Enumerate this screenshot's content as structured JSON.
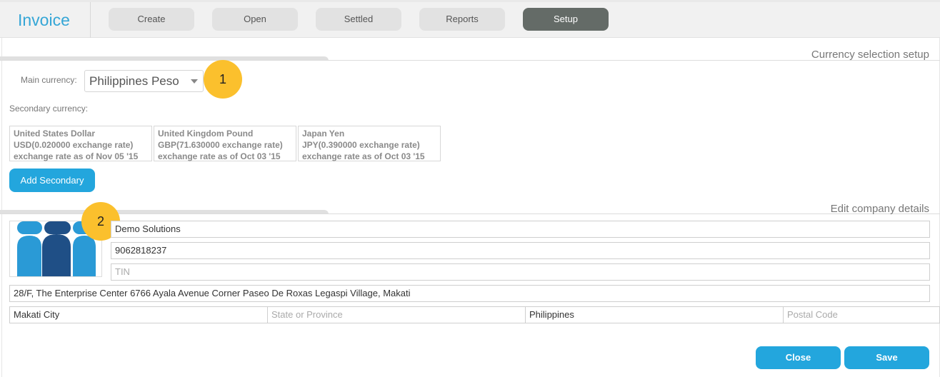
{
  "app": {
    "title": "Invoice"
  },
  "nav": {
    "tabs": [
      {
        "label": "Create"
      },
      {
        "label": "Open"
      },
      {
        "label": "Settled"
      },
      {
        "label": "Reports"
      },
      {
        "label": "Setup",
        "active": true
      }
    ]
  },
  "currency_section": {
    "title": "Currency selection setup",
    "main_label": "Main currency:",
    "main_value": "Philippines Peso",
    "secondary_label": "Secondary currency:",
    "secondary": [
      {
        "name": "United States Dollar",
        "rate": "USD(0.020000 exchange rate)",
        "as_of": "exchange rate as of Nov 05 '15"
      },
      {
        "name": "United Kingdom Pound",
        "rate": "GBP(71.630000 exchange rate)",
        "as_of": "exchange rate as of Oct 03 '15"
      },
      {
        "name": "Japan Yen",
        "rate": "JPY(0.390000 exchange rate)",
        "as_of": "exchange rate as of Oct 03 '15"
      }
    ],
    "add_button": "Add Secondary"
  },
  "markers": {
    "one": "1",
    "two": "2"
  },
  "company_section": {
    "title": "Edit company details",
    "name": "Demo Solutions",
    "phone": "9062818237",
    "tin_placeholder": "TIN",
    "address": "28/F, The Enterprise Center 6766 Ayala Avenue Corner Paseo De Roxas Legaspi Village, Makati",
    "city": "Makati City",
    "state_placeholder": "State or Province",
    "country": "Philippines",
    "postal_placeholder": "Postal Code"
  },
  "footer": {
    "close_label": "Close",
    "save_label": "Save"
  },
  "colors": {
    "accent": "#23a6dd",
    "marker": "#fbc02d",
    "active_tab": "#646b67"
  },
  "icons": {
    "dropdown": "chevron-down-icon"
  }
}
